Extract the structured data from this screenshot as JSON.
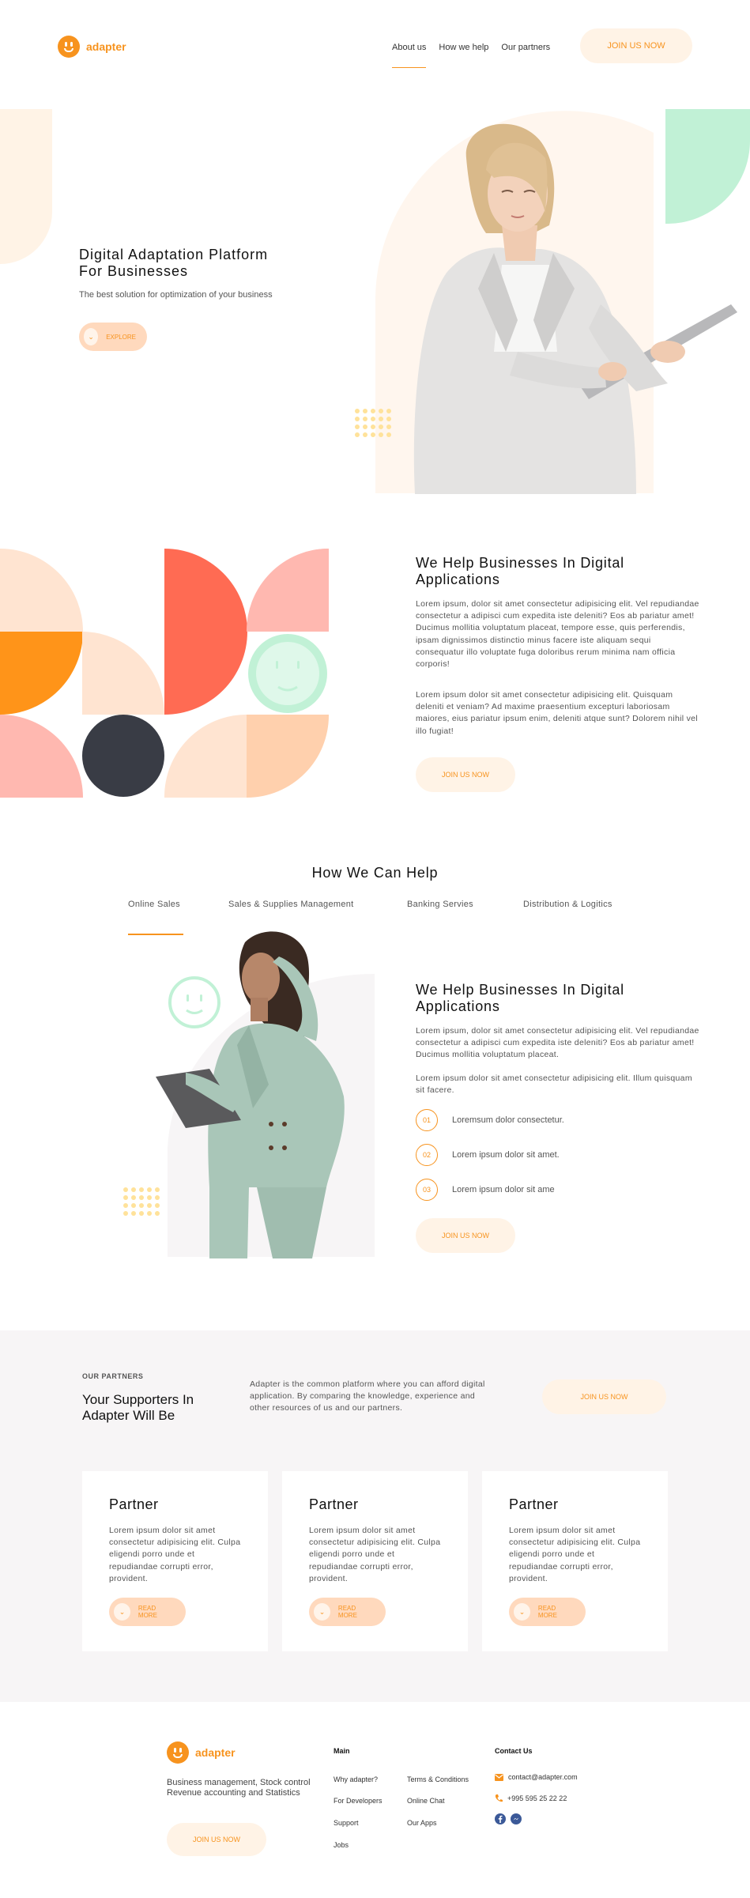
{
  "header": {
    "brand": "adapter",
    "nav": [
      "About us",
      "How we help",
      "Our partners"
    ],
    "join_label": "JOIN US NOW"
  },
  "hero": {
    "title_line1": "Digital Adaptation Platform",
    "title_line2": "For Businesses",
    "subtitle": "The best solution for optimization of your business",
    "explore_label": "EXPLORE"
  },
  "help": {
    "title_line1": "We Help Businesses In Digital",
    "title_line2": "Applications",
    "para1": "Lorem ipsum, dolor sit amet consectetur adipisicing elit. Vel repudiandae consectetur a adipisci cum expedita iste deleniti? Eos ab pariatur amet! Ducimus mollitia voluptatum placeat, tempore esse, quis perferendis, ipsam dignissimos distinctio minus facere iste aliquam sequi consequatur illo voluptate fuga doloribus rerum minima nam officia corporis!",
    "para2": "Lorem ipsum dolor sit amet consectetur adipisicing elit. Quisquam deleniti et veniam? Ad maxime praesentium excepturi laboriosam maiores, eius pariatur ipsum enim, deleniti atque sunt? Dolorem nihil vel illo fugiat!",
    "join_label": "JOIN US NOW"
  },
  "how": {
    "title": "How We Can Help",
    "tabs": [
      "Online Sales",
      "Sales & Supplies Management",
      "Banking Servies",
      "Distribution & Logitics"
    ],
    "card_title_line1": "We Help Businesses In Digital",
    "card_title_line2": "Applications",
    "para1": "Lorem ipsum, dolor sit amet consectetur adipisicing elit. Vel repudiandae consectetur a adipisci cum expedita iste deleniti? Eos ab pariatur amet! Ducimus mollitia voluptatum placeat.",
    "para2": "Lorem ipsum dolor sit amet consectetur adipisicing elit. Illum quisquam sit facere.",
    "steps": [
      {
        "num": "01",
        "text": "Loremsum dolor consectetur."
      },
      {
        "num": "02",
        "text": "Lorem ipsum dolor sit amet."
      },
      {
        "num": "03",
        "text": "Lorem ipsum dolor sit ame"
      }
    ],
    "join_label": "JOIN US NOW"
  },
  "partners": {
    "eyebrow": "OUR PARTNERS",
    "title_line1": "Your Supporters In",
    "title_line2": "Adapter Will Be",
    "description": "Adapter is the common platform where you can afford digital application. By comparing the knowledge, experience and other resources of us and our partners.",
    "join_label": "JOIN US NOW",
    "cards": [
      {
        "title": "Partner",
        "text": "Lorem ipsum dolor sit amet consectetur adipisicing elit. Culpa eligendi porro unde et repudiandae corrupti error, provident.",
        "cta": "READ MORE"
      },
      {
        "title": "Partner",
        "text": "Lorem ipsum dolor sit amet consectetur adipisicing elit. Culpa eligendi porro unde et repudiandae corrupti error, provident.",
        "cta": "READ MORE"
      },
      {
        "title": "Partner",
        "text": "Lorem ipsum dolor sit amet consectetur adipisicing elit. Culpa eligendi porro unde et repudiandae corrupti error, provident.",
        "cta": "READ MORE"
      }
    ]
  },
  "footer": {
    "brand": "adapter",
    "tagline": "Business management, Stock control Revenue accounting and Statistics",
    "join_label": "JOIN US NOW",
    "main_title": "Main",
    "main_col1": [
      "Why adapter?",
      "For Developers",
      "Support",
      "Jobs"
    ],
    "main_col2": [
      "Terms & Conditions",
      "Online Chat",
      "Our Apps"
    ],
    "contact_title": "Contact Us",
    "email": "contact@adapter.com",
    "phone": "+995 595 25 22 22"
  },
  "colors": {
    "accent": "#f7931e",
    "soft_peach": "#fff3e6",
    "partners_bg": "#f7f5f6",
    "mint": "#c1f1d6",
    "coral": "#ff6b53"
  }
}
